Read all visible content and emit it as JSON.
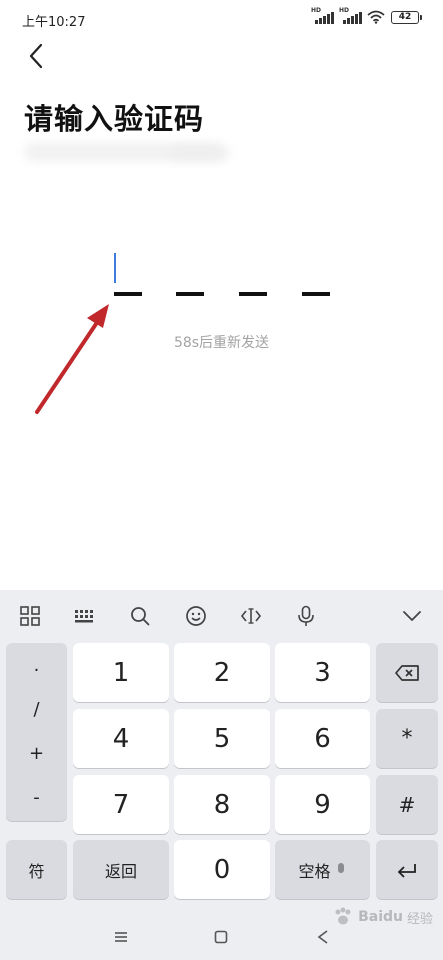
{
  "status_bar": {
    "time": "上午10:27",
    "signal_1_label": "HD",
    "signal_2_label": "HD",
    "battery": "42"
  },
  "header": {
    "back_icon": "chevron-left-icon",
    "title": "请输入验证码"
  },
  "code_input": {
    "slots": 4,
    "caret_color": "#3d7be0",
    "resend_text": "58s后重新发送"
  },
  "annotation": {
    "arrow_color": "#c0282c"
  },
  "keyboard": {
    "toolbar": [
      "grid-apps-icon",
      "keyboard-icon",
      "search-icon",
      "emoji-icon",
      "cursor-move-icon",
      "mic-icon",
      "collapse-chevron-icon"
    ],
    "symbols": [
      ".",
      "/",
      "+",
      "-"
    ],
    "digits": [
      "1",
      "2",
      "3",
      "4",
      "5",
      "6",
      "7",
      "8",
      "9",
      "0"
    ],
    "backspace_icon": "backspace-icon",
    "star": "*",
    "hash": "#",
    "sym_label": "符",
    "return_label": "返回",
    "space_label": "空格",
    "enter_icon": "enter-icon"
  },
  "navbar": {
    "menu_icon": "menu-icon",
    "home_icon": "home-square-icon",
    "back_icon": "back-triangle-icon"
  },
  "watermark": {
    "brand": "Baidu",
    "cn": "经验"
  }
}
